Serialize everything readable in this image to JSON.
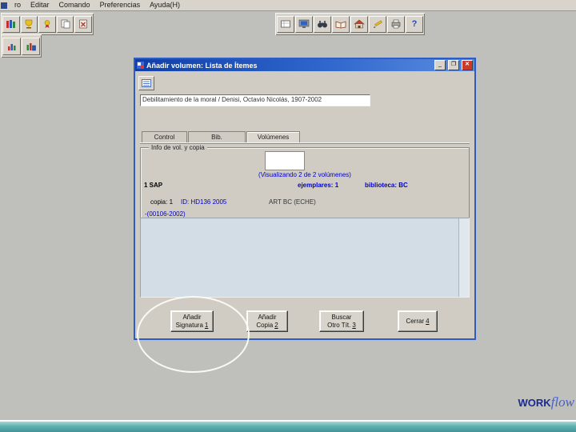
{
  "menubar": {
    "items": [
      {
        "label": "ro"
      },
      {
        "label": "Editar"
      },
      {
        "label": "Comando"
      },
      {
        "label": "Preferencias"
      },
      {
        "label": "Ayuda(H)"
      }
    ]
  },
  "toolbars": {
    "main_icons": [
      "books-icon",
      "trophy-icon",
      "medal-icon",
      "sheets-icon",
      "clipboard-x-icon"
    ],
    "center_icons": [
      "card-grid-icon",
      "monitor-icon",
      "binoculars-icon",
      "open-book-icon",
      "home-icon",
      "pencil-icon",
      "printer-icon",
      "help-icon"
    ],
    "secondary_icons": [
      "bar-chart-icon",
      "bar-chart-book-icon"
    ]
  },
  "dialog": {
    "title": "Añadir volumen: Lista de Ítemes",
    "window_controls": {
      "minimize": "_",
      "maximize": "❐",
      "close": "✕"
    },
    "record_text": "Debilitamiento de la moral / Denisi, Octavio Nicolás, 1907-2002",
    "tabs": [
      {
        "label": "Control"
      },
      {
        "label": "Bib."
      },
      {
        "label": "Volúmenes"
      }
    ],
    "group_label": "Info de vol. y copia",
    "viewing_note": "(Visualizando 2 de 2 volúmenes)",
    "row1": {
      "sap": "1 SAP",
      "ejemplares": "ejemplares: 1",
      "biblioteca": "biblioteca: BC"
    },
    "row2": {
      "copia": "copia: 1",
      "id": "ID: HD136 2005",
      "location": "ART BC (ECHE)"
    },
    "row3": {
      "code": "-(00106-2002)"
    },
    "buttons": [
      {
        "top": "Añadir",
        "bottom": "Signatura",
        "shortcut": "1"
      },
      {
        "top": "Añadir",
        "bottom": "Copia",
        "shortcut": "2"
      },
      {
        "top": "Buscar",
        "bottom": "Otro Tít.",
        "shortcut": "3"
      },
      {
        "top": "",
        "bottom": "Cerrar",
        "shortcut": "4"
      }
    ]
  },
  "logo": {
    "work": "WORK",
    "flow": "flow"
  },
  "colors": {
    "titlebar_gradient_start": "#0f3ea8",
    "titlebar_gradient_end": "#5a8ce0",
    "accent_blue_text": "#0000cc",
    "dialog_border": "#2f5cc4",
    "list_area": "#d2dde6",
    "taskbar_teal": "#5fb0b0",
    "logo_navy": "#1a2a94",
    "window_gray": "#bfbfbb"
  }
}
